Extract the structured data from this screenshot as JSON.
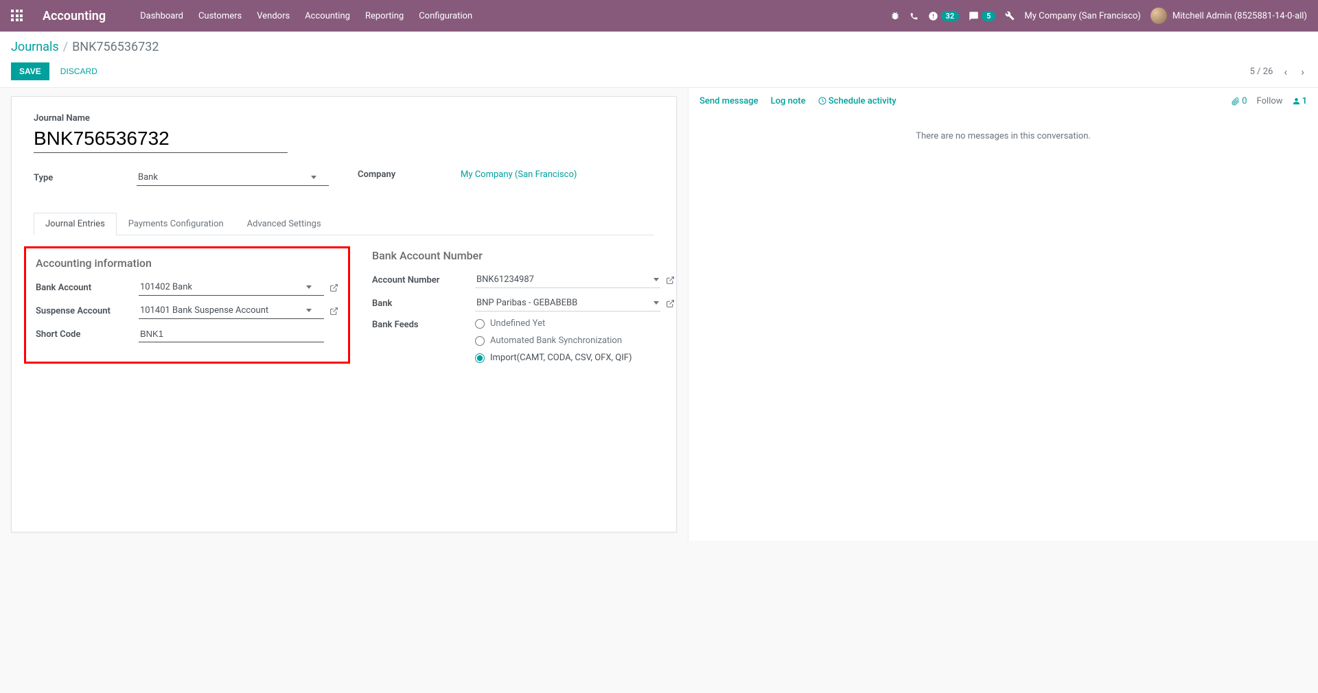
{
  "nav": {
    "brand": "Accounting",
    "items": [
      "Dashboard",
      "Customers",
      "Vendors",
      "Accounting",
      "Reporting",
      "Configuration"
    ],
    "activities_count": "32",
    "messages_count": "5",
    "company": "My Company (San Francisco)",
    "user": "Mitchell Admin (8525881-14-0-all)"
  },
  "breadcrumb": {
    "parent": "Journals",
    "current": "BNK756536732"
  },
  "actions": {
    "save": "SAVE",
    "discard": "DISCARD"
  },
  "pager": {
    "text": "5 / 26"
  },
  "form": {
    "jname_label": "Journal Name",
    "jname_value": "BNK756536732",
    "type_label": "Type",
    "type_value": "Bank",
    "company_label": "Company",
    "company_value": "My Company (San Francisco)"
  },
  "tabs": {
    "t1": "Journal Entries",
    "t2": "Payments Configuration",
    "t3": "Advanced Settings"
  },
  "acct_info": {
    "heading": "Accounting information",
    "bank_account_label": "Bank Account",
    "bank_account_value": "101402 Bank",
    "suspense_label": "Suspense Account",
    "suspense_value": "101401 Bank Suspense Account",
    "shortcode_label": "Short Code",
    "shortcode_value": "BNK1"
  },
  "bank_num": {
    "heading": "Bank Account Number",
    "acctnum_label": "Account Number",
    "acctnum_value": "BNK61234987",
    "bank_label": "Bank",
    "bank_value": "BNP Paribas - GEBABEBB",
    "feeds_label": "Bank Feeds",
    "opt1": "Undefined Yet",
    "opt2": "Automated Bank Synchronization",
    "opt3": "Import(CAMT, CODA, CSV, OFX, QIF)"
  },
  "chatter": {
    "send": "Send message",
    "lognote": "Log note",
    "schedule": "Schedule activity",
    "attach_count": "0",
    "follow": "Follow",
    "follower_count": "1",
    "empty": "There are no messages in this conversation."
  }
}
